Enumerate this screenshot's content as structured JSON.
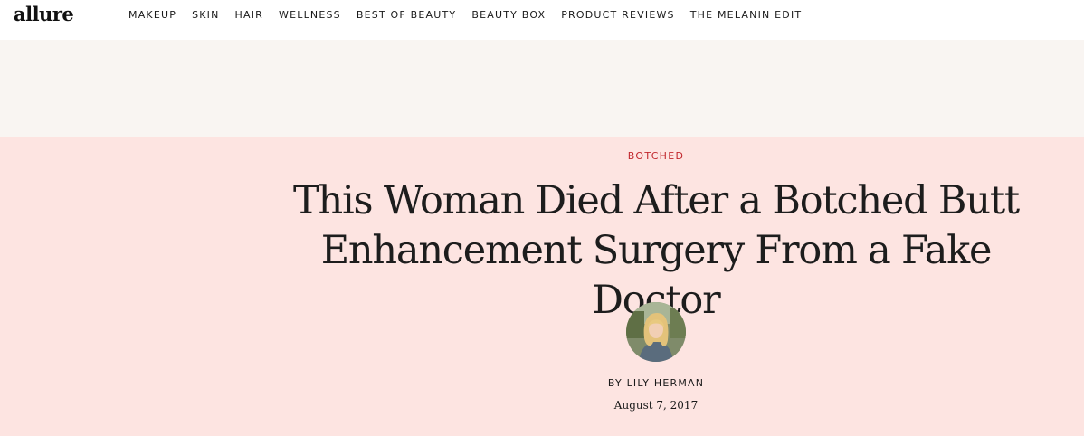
{
  "site": {
    "logo_text": "allure",
    "nav": [
      "MAKEUP",
      "SKIN",
      "HAIR",
      "WELLNESS",
      "BEST OF BEAUTY",
      "BEAUTY BOX",
      "PRODUCT REVIEWS",
      "THE MELANIN EDIT"
    ]
  },
  "article": {
    "rubric": "BOTCHED",
    "headline": "This Woman Died After a Botched Butt Enhancement Surgery From a Fake Doctor",
    "byline_prefix": "BY ",
    "author": "LILY HERMAN",
    "date": "August 7, 2017"
  },
  "colors": {
    "hero_background": "#fde4e1",
    "ad_band_background": "#f9f5f2",
    "rubric": "#c1272d",
    "text": "#1a1a1a"
  }
}
